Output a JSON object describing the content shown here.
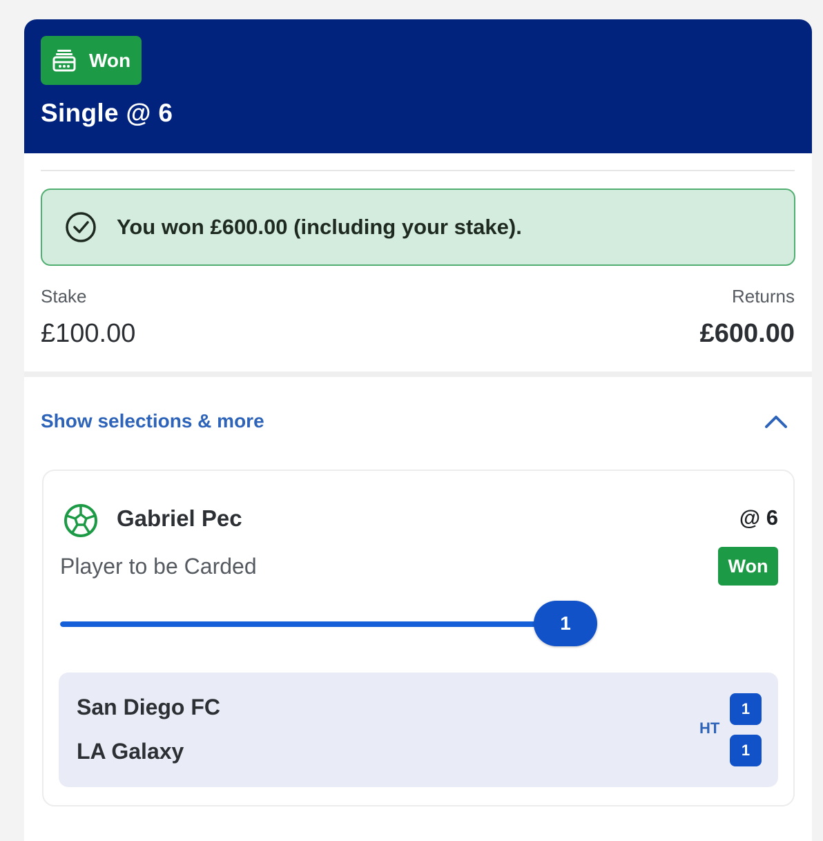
{
  "colors": {
    "header_bg": "#01237d",
    "won_green": "#1d9a45",
    "win_banner_bg": "#d3ecdd",
    "link_blue": "#2d63b8",
    "accent_blue": "#1152c9"
  },
  "header": {
    "status_badge": {
      "icon": "cash-register-icon",
      "label": "Won"
    },
    "title": "Single @ 6"
  },
  "win_banner": {
    "icon": "check-circle-icon",
    "message": "You won £600.00 (including your stake)."
  },
  "summary": {
    "stake_label": "Stake",
    "stake_value": "£100.00",
    "returns_label": "Returns",
    "returns_value": "£600.00"
  },
  "selections_toggle": {
    "label": "Show selections & more",
    "icon": "chevron-up-icon",
    "expanded": true
  },
  "selection": {
    "sport_icon": "football-icon",
    "player": "Gabriel Pec",
    "odds": "@ 6",
    "market": "Player to be Carded",
    "result": "Won",
    "progress": {
      "value": "1",
      "fraction": 1.0
    },
    "match": {
      "home_team": "San Diego FC",
      "away_team": "LA Galaxy",
      "period": "HT",
      "home_score": "1",
      "away_score": "1"
    }
  }
}
